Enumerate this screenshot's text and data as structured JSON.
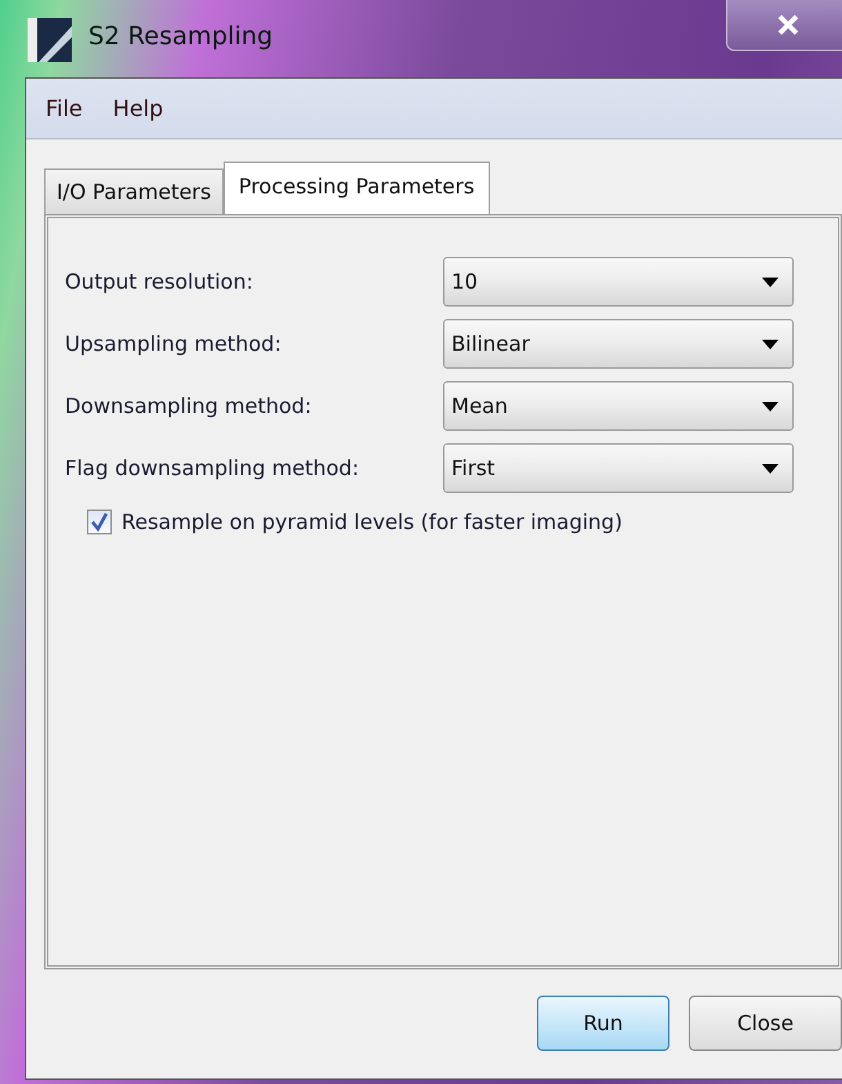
{
  "window": {
    "title": "S2 Resampling"
  },
  "menu": [
    "File",
    "Help"
  ],
  "tabs": [
    {
      "label": "I/O Parameters",
      "selected": false
    },
    {
      "label": "Processing Parameters",
      "selected": true
    }
  ],
  "fields": [
    {
      "label": "Output resolution:",
      "value": "10"
    },
    {
      "label": "Upsampling method:",
      "value": "Bilinear"
    },
    {
      "label": "Downsampling method:",
      "value": "Mean"
    },
    {
      "label": "Flag downsampling method:",
      "value": "First"
    }
  ],
  "checkbox": {
    "label": "Resample on pyramid levels (for faster imaging)",
    "checked": true
  },
  "buttons": [
    {
      "label": "Run",
      "kind": "default"
    },
    {
      "label": "Close",
      "kind": "normal"
    }
  ]
}
